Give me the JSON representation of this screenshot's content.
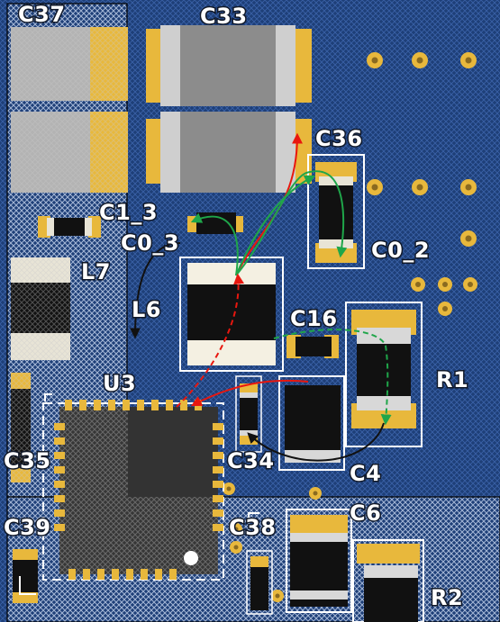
{
  "board": {
    "background_color": "#1e3f78",
    "silkscreen_color": "#ffffff",
    "pad_color": "#e8b83c"
  },
  "labels": {
    "c37": "C37",
    "c33": "C33",
    "c36": "C36",
    "c1_3": "C1_3",
    "c0_3": "C0_3",
    "c0_2": "C0_2",
    "l7": "L7",
    "l6": "L6",
    "c16": "C16",
    "r1": "R1",
    "u3": "U3",
    "c35": "C35",
    "c34": "C34",
    "c4": "C4",
    "c39": "C39",
    "c38": "C38",
    "c6": "C6",
    "r2": "R2"
  },
  "arrows": {
    "colors": {
      "red": "#e8170f",
      "green": "#1fa64a",
      "black": "#111111"
    }
  }
}
